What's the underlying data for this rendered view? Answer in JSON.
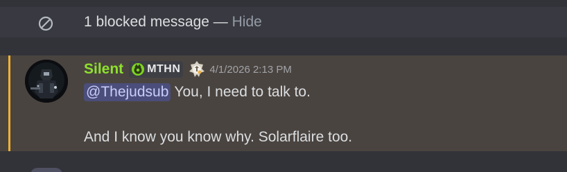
{
  "blocked": {
    "count_text": "1 blocked message",
    "separator": "—",
    "hide_label": "Hide",
    "icon": "blocked-icon"
  },
  "message": {
    "username": "Silent",
    "username_color": "#8ee12d",
    "clan_tag": "MTHN",
    "clan_icon": "clan-badge-icon",
    "role_icon": "role-badge-icon",
    "timestamp": "4/1/2026 2:13 PM",
    "mention": "@Thejudsub",
    "line1_text": "You, I need to talk to.",
    "line2_text": "And I know you know why. Solarflaire too.",
    "highlight_color": "#f0b232"
  }
}
